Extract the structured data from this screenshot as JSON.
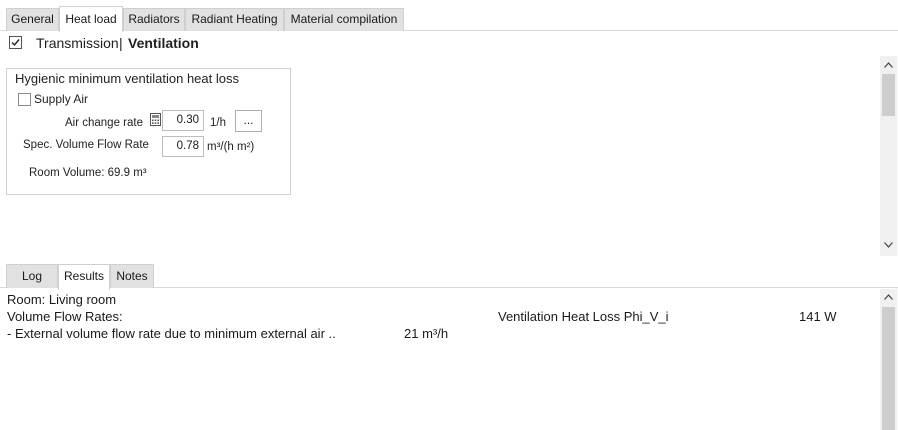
{
  "tabs": [
    {
      "label": "General"
    },
    {
      "label": "Heat load"
    },
    {
      "label": "Radiators"
    },
    {
      "label": "Radiant Heating"
    },
    {
      "label": "Material compilation"
    }
  ],
  "active_tab": "Heat load",
  "subheader": {
    "transmission": "Transmission",
    "separator": "|",
    "ventilation": "Ventilation",
    "checked": true
  },
  "group": {
    "title": "Hygienic minimum ventilation heat loss",
    "supply_air_label": "Supply Air",
    "supply_air_checked": false,
    "air_change_rate_label": "Air change rate",
    "air_change_rate_value": "0.30",
    "air_change_rate_unit": "1/h",
    "more_button": "...",
    "spec_flow_label": "Spec. Volume Flow Rate",
    "spec_flow_value": "0.78",
    "spec_flow_unit": "m³/(h m²)",
    "room_volume": "Room Volume: 69.9 m³"
  },
  "bottom_tabs": [
    {
      "label": "Log"
    },
    {
      "label": "Results"
    },
    {
      "label": "Notes"
    }
  ],
  "active_bottom_tab": "Results",
  "results": {
    "room": "Room: Living room",
    "flow_rates": "Volume Flow Rates:",
    "external_label": "- External volume flow rate due to minimum external air ..",
    "external_value": "21 m³/h",
    "heat_loss_label": "Ventilation Heat Loss Phi_V_i",
    "heat_loss_value": "141 W"
  },
  "icons": {
    "checkmark": "checkmark-icon",
    "calculator": "calculator-icon",
    "scroll_up": "chevron-up-icon",
    "scroll_down": "chevron-down-icon"
  }
}
